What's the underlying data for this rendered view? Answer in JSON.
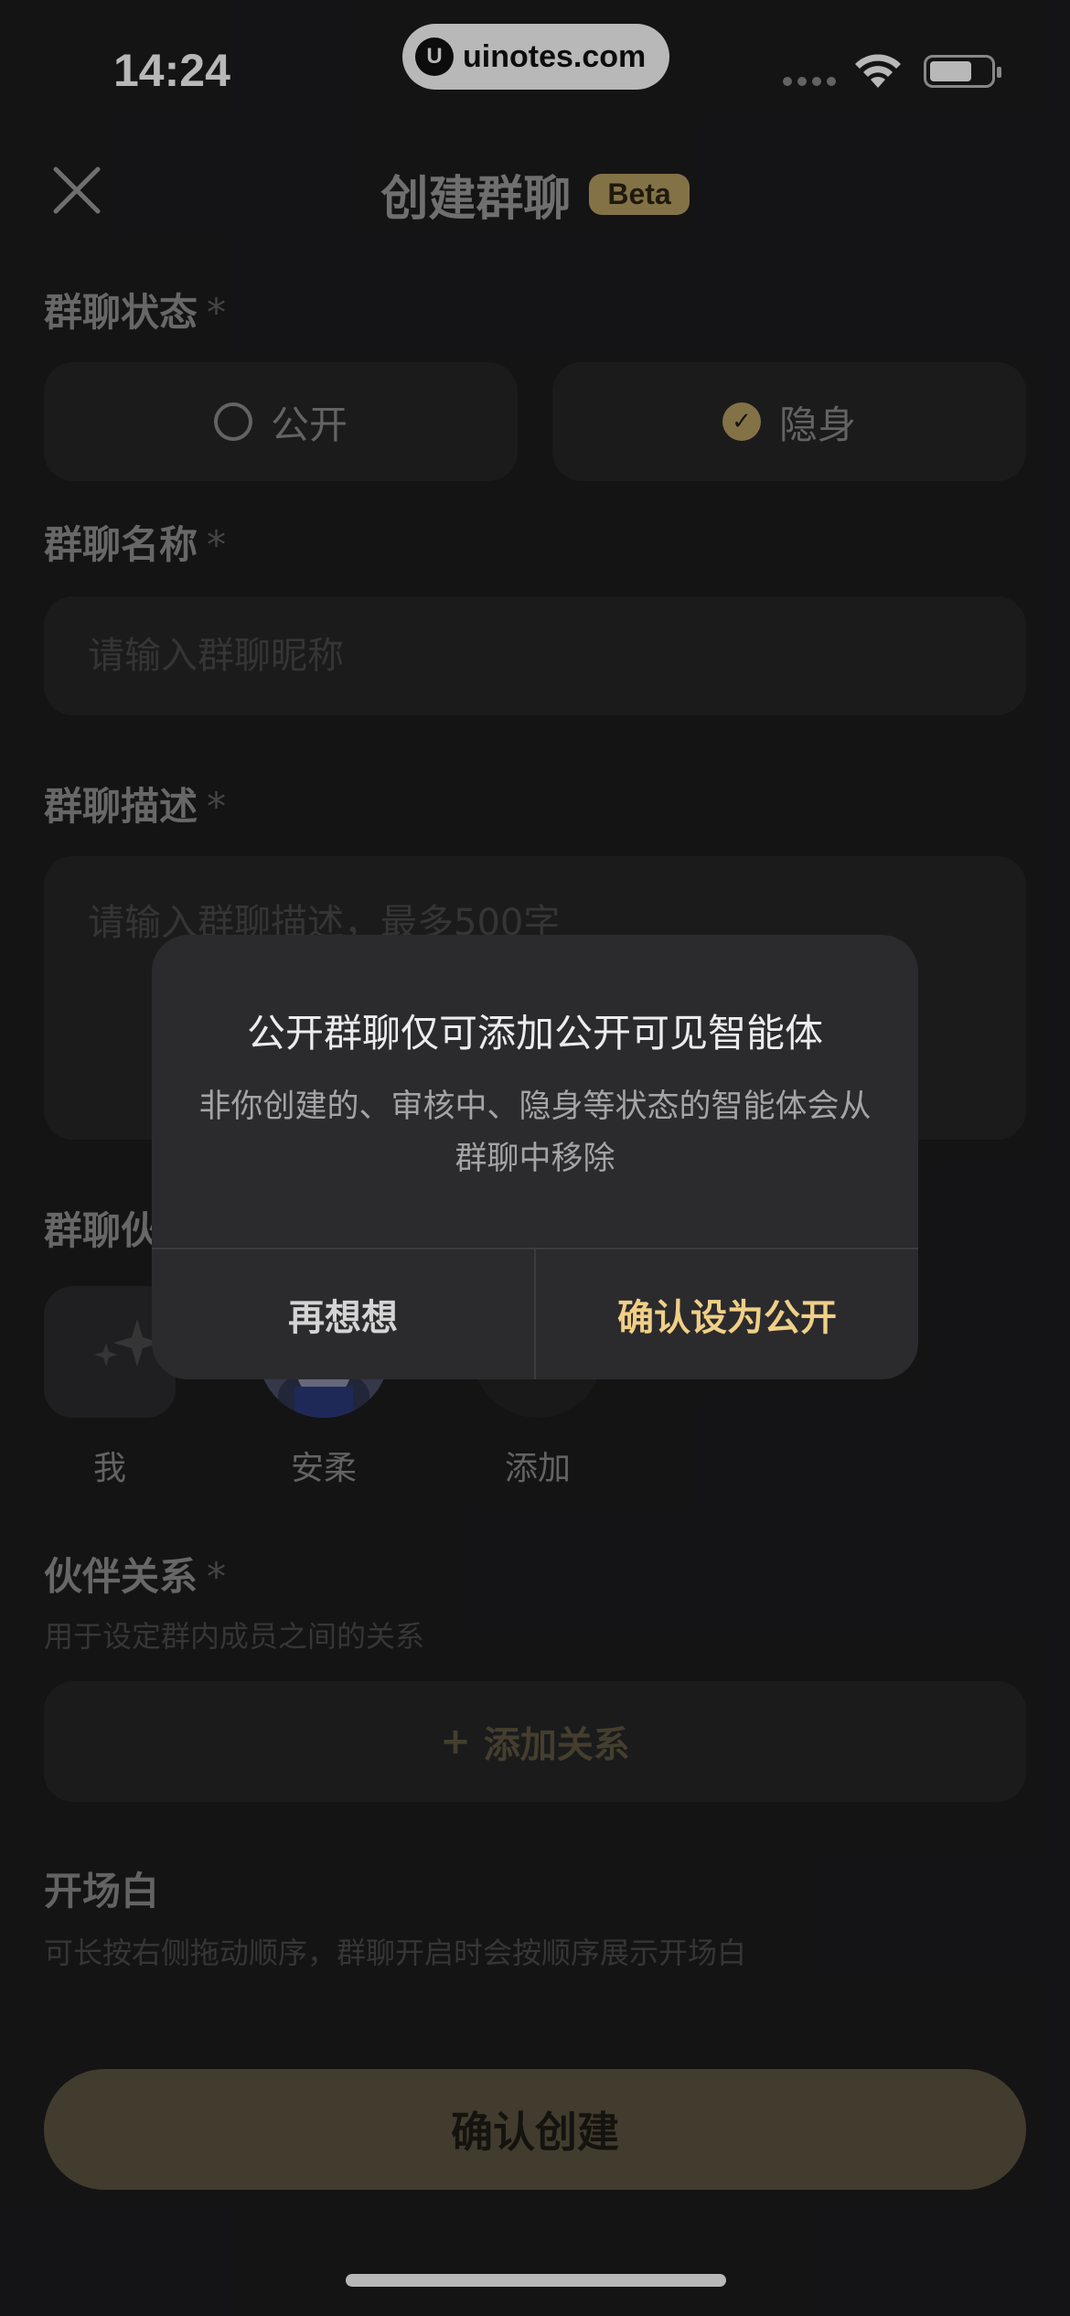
{
  "status_bar": {
    "time": "14:24",
    "url": "uinotes.com",
    "url_logo": "U"
  },
  "header": {
    "title": "创建群聊",
    "badge": "Beta"
  },
  "group_status": {
    "label": "群聊状态",
    "required_mark": "*",
    "options": [
      {
        "label": "公开",
        "selected": false
      },
      {
        "label": "隐身",
        "selected": true
      }
    ]
  },
  "group_name": {
    "label": "群聊名称",
    "required_mark": "*",
    "placeholder": "请输入群聊昵称"
  },
  "group_desc": {
    "label": "群聊描述",
    "required_mark": "*",
    "placeholder": "请输入群聊描述，最多500字"
  },
  "partners": {
    "label": "群聊伙",
    "members": [
      {
        "name": "我"
      },
      {
        "name": "安柔"
      },
      {
        "name": "添加"
      }
    ]
  },
  "relations": {
    "label": "伙伴关系",
    "required_mark": "*",
    "hint": "用于设定群内成员之间的关系",
    "add_label": "添加关系",
    "add_icon": "+"
  },
  "opening": {
    "label": "开场白",
    "hint": "可长按右侧拖动顺序，群聊开启时会按顺序展示开场白"
  },
  "footer": {
    "confirm_label": "确认创建"
  },
  "dialog": {
    "title": "公开群聊仅可添加公开可见智能体",
    "message": "非你创建的、审核中、隐身等状态的智能体会从群聊中移除",
    "cancel_label": "再想想",
    "confirm_label": "确认设为公开"
  },
  "colors": {
    "accent": "#b89e63",
    "dialog_confirm": "#f0cf86",
    "background": "#1c1c1e"
  }
}
